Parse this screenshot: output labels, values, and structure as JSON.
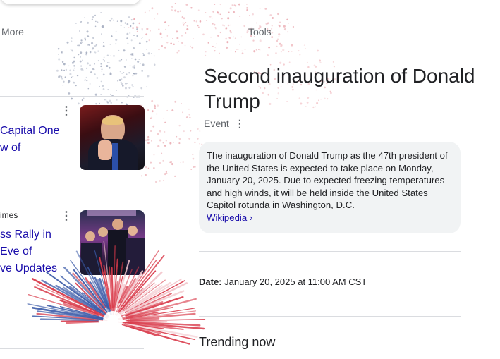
{
  "tabs": {
    "more": "More",
    "tools": "Tools"
  },
  "news": [
    {
      "source": "",
      "headline": "Capital One\nw of"
    },
    {
      "source": "imes",
      "headline": "ss Rally in\nEve of\nve Updates"
    }
  ],
  "knowledge_panel": {
    "title": "Second inauguration of Donald Trump",
    "type": "Event",
    "description": "The inauguration of Donald Trump as the 47th president of the United States is expected to take place on Monday, January 20, 2025. Due to expected freezing temperatures and high winds, it will be held inside the United States Capitol rotunda in Washington, D.C.",
    "source_link": "Wikipedia ›",
    "date_label": "Date:",
    "date_value": "January 20, 2025 at 11:00 AM CST",
    "trending_heading": "Trending now"
  },
  "colors": {
    "link": "#1a0dab",
    "firework_red": "#d93a4a",
    "firework_blue": "#3a5aa8"
  },
  "icons": {
    "kebab": "more-vert-icon"
  }
}
